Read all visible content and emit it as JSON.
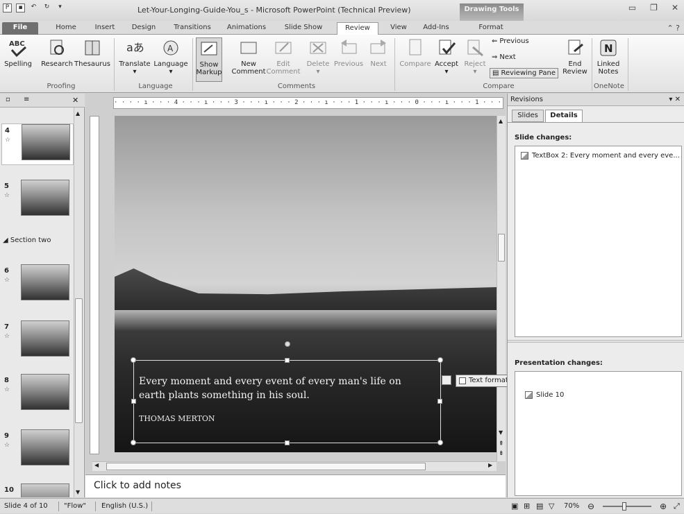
{
  "window": {
    "title": "Let-Your-Longing-Guide-You_s - Microsoft PowerPoint (Technical Preview)",
    "context_tab": "Drawing Tools",
    "buttons": [
      "minimize",
      "restore",
      "close"
    ]
  },
  "tabs": [
    {
      "label": "File"
    },
    {
      "label": "Home"
    },
    {
      "label": "Insert"
    },
    {
      "label": "Design"
    },
    {
      "label": "Transitions"
    },
    {
      "label": "Animations"
    },
    {
      "label": "Slide Show"
    },
    {
      "label": "Review"
    },
    {
      "label": "View"
    },
    {
      "label": "Add-Ins"
    },
    {
      "label": "Format"
    }
  ],
  "active_tab": "Review",
  "ribbon": {
    "groups": {
      "proofing": "Proofing",
      "language": "Language",
      "comments": "Comments",
      "compare": "Compare",
      "onenote": "OneNote"
    },
    "buttons": {
      "spelling": "Spelling",
      "research": "Research",
      "thesaurus": "Thesaurus",
      "translate": "Translate",
      "language": "Language",
      "show_markup_1": "Show",
      "show_markup_2": "Markup",
      "new_comment_1": "New",
      "new_comment_2": "Comment",
      "edit_comment_1": "Edit",
      "edit_comment_2": "Comment",
      "delete": "Delete",
      "previous": "Previous",
      "next": "Next",
      "compare": "Compare",
      "accept": "Accept",
      "reject": "Reject",
      "previous_small": "Previous",
      "next_small": "Next",
      "reviewing_pane": "Reviewing Pane",
      "end_review_1": "End",
      "end_review_2": "Review",
      "linked_notes_1": "Linked",
      "linked_notes_2": "Notes"
    }
  },
  "thumbnails": [
    {
      "num": "4",
      "selected": true
    },
    {
      "num": "5",
      "selected": false
    },
    {
      "num": "6",
      "selected": false
    },
    {
      "num": "7",
      "selected": false
    },
    {
      "num": "8",
      "selected": false
    },
    {
      "num": "9",
      "selected": false
    },
    {
      "num": "10",
      "selected": false
    }
  ],
  "section_label": "Section two",
  "ruler_text": "· · · · ı · · · 4 · · · ı · · · 3 · · · ı · · · 2 · · · ı · · · 1 · · · ı · · · 0 · · · ı · · · 1 · · · ı · · · 2 · · · ı · · · 3 · · · ı",
  "slide": {
    "quote": "Every moment and every event of every man's life on earth plants something in his soul.",
    "author": "THOMAS MERTON"
  },
  "revision_popup": "Text format: typeface (Katherine)",
  "notes_placeholder": "Click to add notes",
  "revisions_pane": {
    "title": "Revisions",
    "tabs": [
      "Slides",
      "Details"
    ],
    "active_tab": "Details",
    "slide_changes_heading": "Slide changes:",
    "slide_changes": [
      "TextBox 2: Every moment and every eve..."
    ],
    "presentation_changes_heading": "Presentation changes:",
    "presentation_changes": [
      "Slide 10"
    ]
  },
  "status": {
    "slide_info": "Slide 4 of 10",
    "theme": "\"Flow\"",
    "language": "English (U.S.)",
    "zoom": "70%"
  }
}
